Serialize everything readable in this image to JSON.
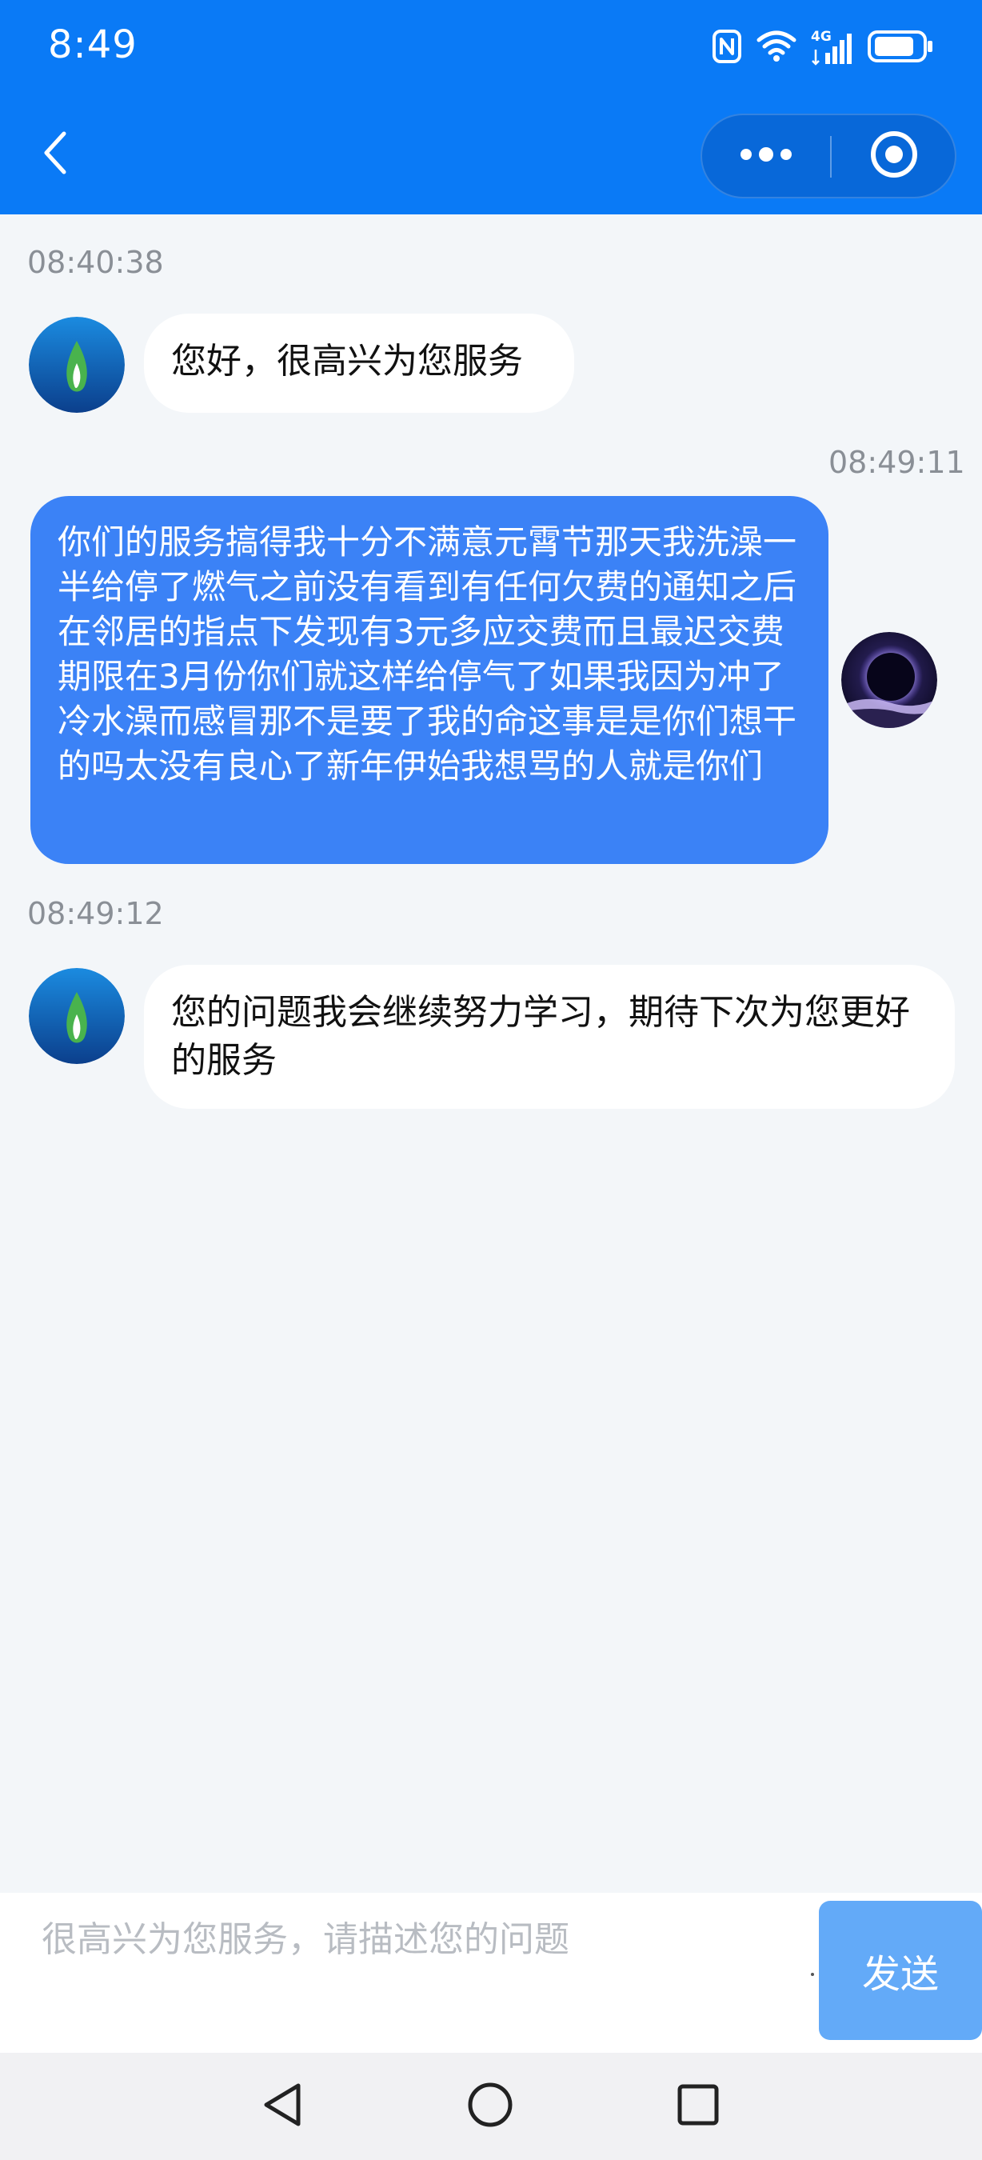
{
  "status_bar": {
    "time": "8:49",
    "network_label": "4G",
    "icons": [
      "nfc-icon",
      "wifi-icon",
      "signal-icon",
      "battery-icon"
    ]
  },
  "header": {
    "back_icon": "chevron-left-icon",
    "more_icon": "more-dots-icon",
    "close_icon": "target-circle-icon",
    "background_color": "#0a7af6"
  },
  "messages": [
    {
      "timestamp": "08:40:38",
      "sender": "agent",
      "avatar_icon": "gas-flame-logo-icon",
      "text": "您好，很高兴为您服务"
    },
    {
      "timestamp": "08:49:11",
      "sender": "user",
      "avatar_icon": "eclipse-avatar-icon",
      "text": "你们的服务搞得我十分不满意元霄节那天我洗澡一半给停了燃气之前没有看到有任何欠费的通知之后在邻居的指点下发现有3元多应交费而且最迟交费期限在3月份你们就这样给停气了如果我因为冲了冷水澡而感冒那不是要了我的命这事是是你们想干的吗太没有良心了新年伊始我想骂的人就是你们"
    },
    {
      "timestamp": "08:49:12",
      "sender": "agent",
      "avatar_icon": "gas-flame-logo-icon",
      "text": "您的问题我会继续努力学习，期待下次为您更好的服务"
    }
  ],
  "input": {
    "placeholder": "很高兴为您服务，请描述您的问题",
    "value": "",
    "send_label": "发送"
  },
  "nav_bar": {
    "icons": [
      "nav-back-icon",
      "nav-home-icon",
      "nav-recents-icon"
    ]
  },
  "colors": {
    "user_bubble": "#3b82f6",
    "agent_bubble": "#ffffff",
    "send_button": "#63aaf8",
    "page_background": "#f3f6f9"
  }
}
